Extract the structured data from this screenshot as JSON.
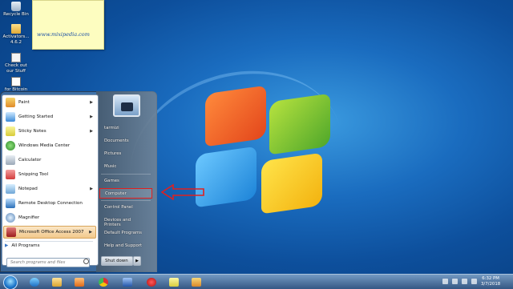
{
  "desktop": {
    "icons": [
      {
        "label": "Recycle Bin"
      },
      {
        "label": "Activators... 4.6.2"
      },
      {
        "label": "Check out our Stuff"
      },
      {
        "label": "for Bitcoin"
      }
    ],
    "sticky_text": "www.mixipedia.com"
  },
  "start_menu": {
    "programs": [
      {
        "label": "Paint",
        "has_arrow": true
      },
      {
        "label": "Getting Started",
        "has_arrow": true
      },
      {
        "label": "Sticky Notes",
        "has_arrow": true
      },
      {
        "label": "Windows Media Center",
        "has_arrow": false
      },
      {
        "label": "Calculator",
        "has_arrow": false
      },
      {
        "label": "Snipping Tool",
        "has_arrow": false
      },
      {
        "label": "Notepad",
        "has_arrow": true
      },
      {
        "label": "Remote Desktop Connection",
        "has_arrow": false
      },
      {
        "label": "Magnifier",
        "has_arrow": false
      },
      {
        "label": "Microsoft Office Access 2007",
        "has_arrow": true
      }
    ],
    "all_programs": "All Programs",
    "search_placeholder": "Search programs and files",
    "user_name": "tarmizi",
    "right_items": [
      "Documents",
      "Pictures",
      "Music",
      "Games",
      "Computer",
      "Control Panel",
      "Devices and Printers",
      "Default Programs",
      "Help and Support"
    ],
    "highlighted_right_item": "Computer",
    "shutdown_label": "Shut down",
    "arrow_glyph": "▶"
  },
  "taskbar": {
    "time": "6:32 PM",
    "date": "3/7/2018"
  },
  "colors": {
    "highlight_border": "#e0201f",
    "taskbar": "#3c5a82"
  }
}
